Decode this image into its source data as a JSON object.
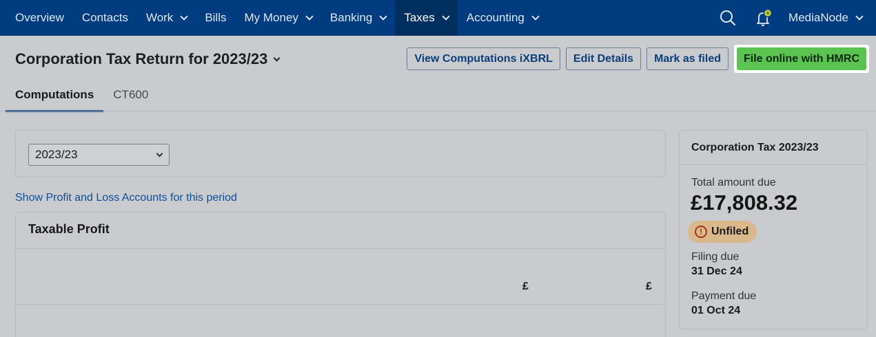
{
  "nav": {
    "items": [
      {
        "label": "Overview",
        "dropdown": false,
        "active": false
      },
      {
        "label": "Contacts",
        "dropdown": false,
        "active": false
      },
      {
        "label": "Work",
        "dropdown": true,
        "active": false
      },
      {
        "label": "Bills",
        "dropdown": false,
        "active": false
      },
      {
        "label": "My Money",
        "dropdown": true,
        "active": false
      },
      {
        "label": "Banking",
        "dropdown": true,
        "active": false
      },
      {
        "label": "Taxes",
        "dropdown": true,
        "active": true
      },
      {
        "label": "Accounting",
        "dropdown": true,
        "active": false
      }
    ],
    "icons": [
      "search-icon",
      "bell-icon"
    ],
    "account_label": "MediaNode"
  },
  "page": {
    "title": "Corporation Tax Return for 2023/23",
    "actions": {
      "view_computations": "View Computations iXBRL",
      "edit_details": "Edit Details",
      "mark_as_filed": "Mark as filed",
      "file_online": "File online with HMRC"
    },
    "tabs": [
      {
        "label": "Computations",
        "active": true
      },
      {
        "label": "CT600",
        "active": false
      }
    ]
  },
  "main": {
    "period_select_value": "2023/23",
    "show_pl_link": "Show Profit and Loss Accounts for this period",
    "taxable_profit": {
      "title": "Taxable Profit",
      "currency_col_1": "£",
      "currency_col_2": "£"
    }
  },
  "summary": {
    "title": "Corporation Tax 2023/23",
    "total_label": "Total amount due",
    "total_value": "£17,808.32",
    "status_badge": "Unfiled",
    "filing_due_label": "Filing due",
    "filing_due_value": "31 Dec 24",
    "payment_due_label": "Payment due",
    "payment_due_value": "01 Oct 24"
  },
  "colors": {
    "nav_bg": "#003d80",
    "primary_button": "#5bc451",
    "link": "#0c4f9a",
    "badge_bg": "#d9b98b"
  }
}
